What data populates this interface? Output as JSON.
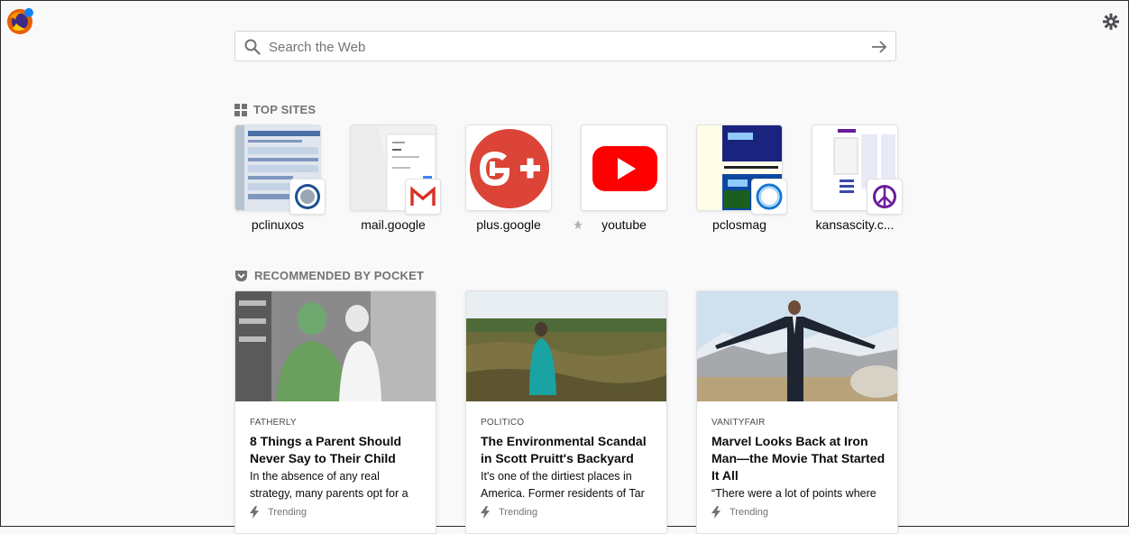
{
  "search": {
    "placeholder": "Search the Web"
  },
  "top_sites": {
    "heading": "TOP SITES",
    "tiles": [
      {
        "label": "pclinuxos"
      },
      {
        "label": "mail.google"
      },
      {
        "label": "plus.google"
      },
      {
        "label": "youtube"
      },
      {
        "label": "pclosmag"
      },
      {
        "label": "kansascity.c..."
      }
    ]
  },
  "pocket": {
    "heading": "RECOMMENDED BY POCKET",
    "cards": [
      {
        "source": "FATHERLY",
        "title": "8 Things a Parent Should Never Say to Their Child",
        "excerpt": "In the absence of any real strategy, many parents opt for a stream-of-",
        "tag": "Trending"
      },
      {
        "source": "POLITICO",
        "title": "The Environmental Scandal in Scott Pruitt's Backyard",
        "excerpt": "It's one of the dirtiest places in America. Former residents of Tar",
        "tag": "Trending"
      },
      {
        "source": "VANITYFAIR",
        "title": "Marvel Looks Back at Iron Man—the Movie That Started It All",
        "excerpt": "“There were a lot of points where",
        "tag": "Trending"
      }
    ]
  },
  "colors": {
    "accent": "#0a84ff",
    "youtube_red": "#ff0000",
    "gplus_red": "#db4437",
    "text_muted": "#737373"
  }
}
